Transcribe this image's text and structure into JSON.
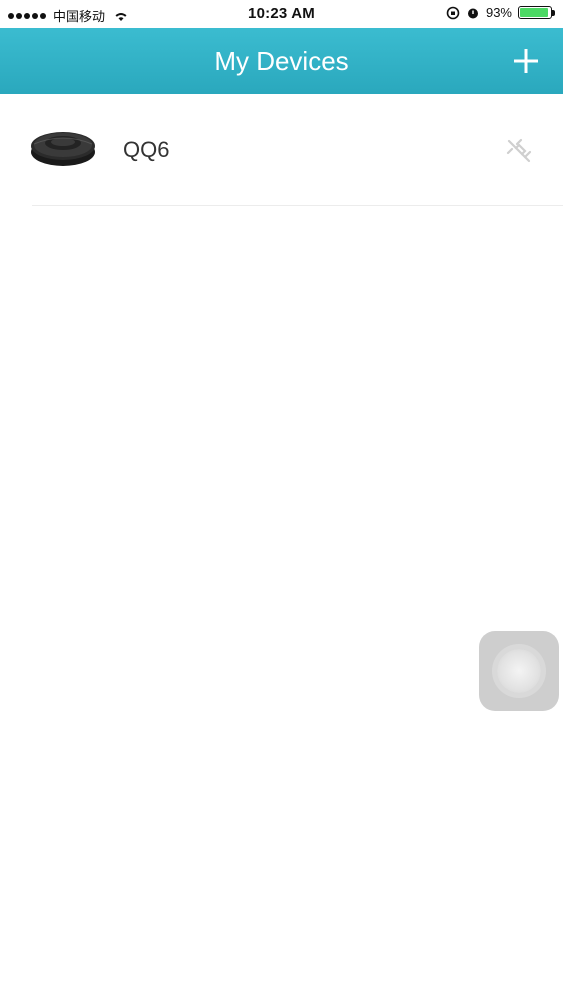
{
  "status_bar": {
    "carrier": "中国移动",
    "time": "10:23 AM",
    "battery_text": "93%",
    "battery_level": 0.93,
    "battery_color": "#4cd964"
  },
  "nav": {
    "title": "My Devices",
    "add_icon": "plus-icon",
    "background_color": "#2fb2c6"
  },
  "devices": [
    {
      "name": "QQ6",
      "thumbnail_icon": "robot-vacuum-icon",
      "status_icon": "disconnected-icon"
    }
  ],
  "assistive_touch": {
    "icon": "assistive-touch-icon"
  }
}
